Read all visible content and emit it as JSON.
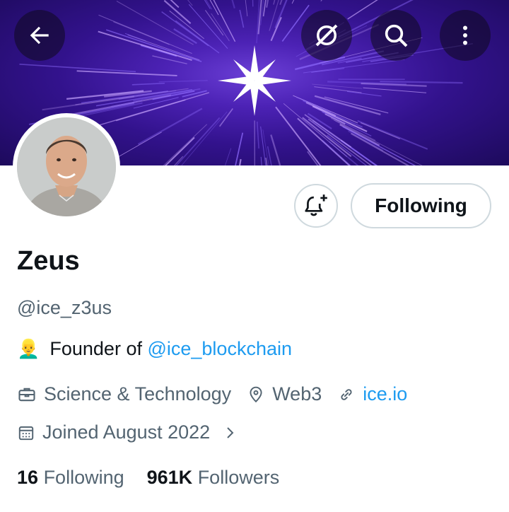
{
  "header": {
    "back_icon": "arrow-left-icon",
    "grok_icon": "grok-icon",
    "search_icon": "search-icon",
    "more_icon": "more-vertical-icon",
    "banner_colors": [
      "#1d0a5c",
      "#4c22b5",
      "#6b3fd6"
    ]
  },
  "profile": {
    "name": "Zeus",
    "handle": "@ice_z3us",
    "bio_emoji": "👱‍♂️",
    "bio_prefix": "Founder of ",
    "bio_mention": "@ice_blockchain",
    "category": "Science & Technology",
    "location": "Web3",
    "website": "ice.io",
    "joined": "Joined August 2022"
  },
  "actions": {
    "follow_label": "Following",
    "bell_icon": "bell-plus-icon"
  },
  "stats": {
    "following_count": "16",
    "following_label": "Following",
    "followers_count": "961K",
    "followers_label": "Followers"
  },
  "colors": {
    "accent": "#1d9bf0",
    "muted": "#536471",
    "text": "#0f1419"
  }
}
